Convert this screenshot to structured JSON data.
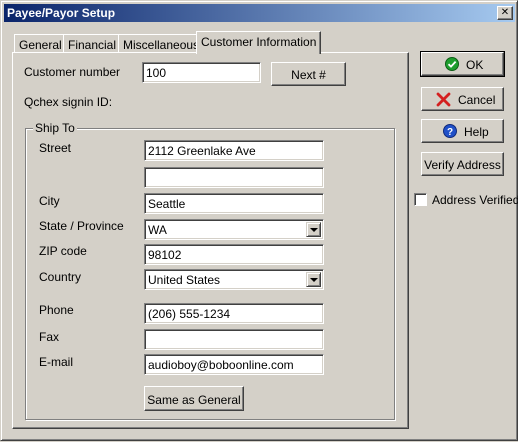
{
  "window": {
    "title": "Payee/Payor Setup",
    "close_glyph": "✕"
  },
  "tabs": [
    {
      "label": "General"
    },
    {
      "label": "Financial"
    },
    {
      "label": "Miscellaneous"
    },
    {
      "label": "Customer Information",
      "active": true
    }
  ],
  "customer": {
    "number_label": "Customer number",
    "number_value": "100",
    "next_label": "Next #",
    "signin_label": "Qchex signin ID:"
  },
  "ship_to": {
    "group_label": "Ship To",
    "street_label": "Street",
    "street_line1": "2112 Greenlake Ave",
    "street_line2": "",
    "city_label": "City",
    "city_value": "Seattle",
    "state_label": "State / Province",
    "state_value": "WA",
    "zip_label": "ZIP code",
    "zip_value": "98102",
    "country_label": "Country",
    "country_value": "United States",
    "phone_label": "Phone",
    "phone_value": "(206) 555-1234",
    "fax_label": "Fax",
    "fax_value": "",
    "email_label": "E-mail",
    "email_value": "audioboy@boboonline.com",
    "same_as_general_label": "Same as General"
  },
  "side_buttons": {
    "ok_label": "OK",
    "cancel_label": "Cancel",
    "help_label": "Help",
    "verify_label": "Verify Address",
    "address_verified_label": "Address Verified",
    "address_verified_checked": false
  },
  "icons": {
    "ok": "check-circle-icon",
    "cancel": "red-x-icon",
    "help": "question-circle-icon"
  },
  "colors": {
    "title_start": "#0a246a",
    "title_end": "#a6caf0",
    "face": "#d4d0c8",
    "ok_icon": "#1e9e2e",
    "cancel_icon": "#d42020",
    "help_icon": "#2050c8"
  }
}
